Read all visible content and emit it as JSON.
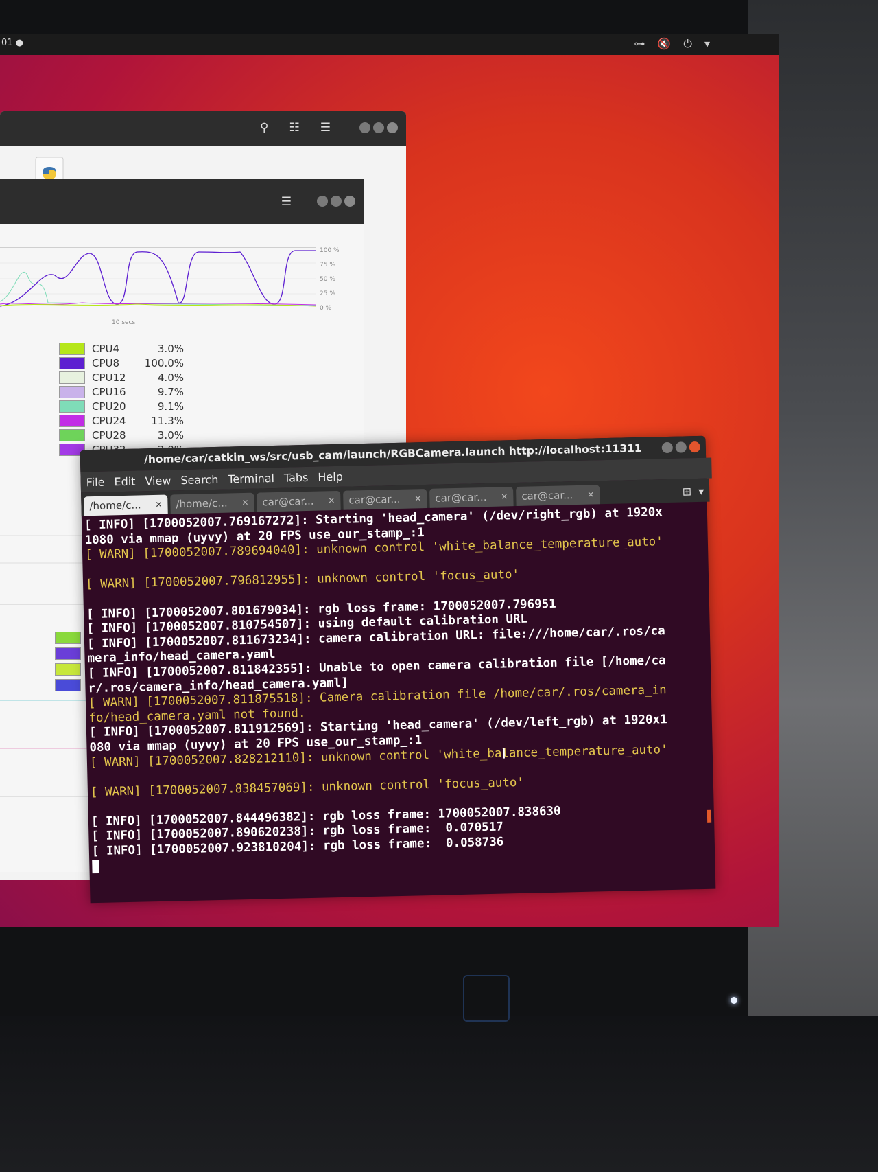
{
  "topbar": {
    "clock": "01 ●",
    "tray_icons": [
      "network-icon",
      "volume-muted-icon",
      "power-icon",
      "chevron-down-icon"
    ]
  },
  "files_window": {
    "icons": [
      "search-icon",
      "view-list-icon",
      "menu-icon"
    ]
  },
  "system_monitor": {
    "axis_labels": [
      "100 %",
      "75 %",
      "50 %",
      "25 %",
      "0 %"
    ],
    "time_label": "10 secs",
    "cpus": [
      {
        "name": "CPU4",
        "value": "3.0%",
        "color": "#b5e619"
      },
      {
        "name": "CPU8",
        "value": "100.0%",
        "color": "#5d1fd1"
      },
      {
        "name": "CPU12",
        "value": "4.0%",
        "color": "#e7f1df"
      },
      {
        "name": "CPU16",
        "value": "9.7%",
        "color": "#c9b2ea"
      },
      {
        "name": "CPU20",
        "value": "9.1%",
        "color": "#7fdcb8"
      },
      {
        "name": "CPU24",
        "value": "11.3%",
        "color": "#c22de6"
      },
      {
        "name": "CPU28",
        "value": "3.0%",
        "color": "#6ed35a"
      },
      {
        "name": "CPU32",
        "value": "2.0%",
        "color": "#a33ae6"
      }
    ],
    "partial_swatch_colors": [
      "#8ad93c",
      "#6a3ed8",
      "#c7e73a",
      "#4a4bd8"
    ]
  },
  "terminal": {
    "title": "/home/car/catkin_ws/src/usb_cam/launch/RGBCamera.launch http://localhost:11311",
    "menu": [
      "File",
      "Edit",
      "View",
      "Search",
      "Terminal",
      "Tabs",
      "Help"
    ],
    "tabs": [
      "/home/c...",
      "/home/c...",
      "car@car...",
      "car@car...",
      "car@car...",
      "car@car..."
    ],
    "lines": [
      {
        "text": "[ INFO] [1700052007.769167272]: Starting 'head_camera' (/dev/right_rgb) at 1920x",
        "level": "info"
      },
      {
        "text": "1080 via mmap (uyvy) at 20 FPS use_our_stamp_:1",
        "level": "info"
      },
      {
        "text": "[ WARN] [1700052007.789694040]: unknown control 'white_balance_temperature_auto'",
        "level": "warn"
      },
      {
        "text": "",
        "level": "info"
      },
      {
        "text": "[ WARN] [1700052007.796812955]: unknown control 'focus_auto'",
        "level": "warn"
      },
      {
        "text": "",
        "level": "info"
      },
      {
        "text": "[ INFO] [1700052007.801679034]: rgb loss frame: 1700052007.796951",
        "level": "info"
      },
      {
        "text": "[ INFO] [1700052007.810754507]: using default calibration URL",
        "level": "info"
      },
      {
        "text": "[ INFO] [1700052007.811673234]: camera calibration URL: file:///home/car/.ros/ca",
        "level": "info"
      },
      {
        "text": "mera_info/head_camera.yaml",
        "level": "info"
      },
      {
        "text": "[ INFO] [1700052007.811842355]: Unable to open camera calibration file [/home/ca",
        "level": "info"
      },
      {
        "text": "r/.ros/camera_info/head_camera.yaml]",
        "level": "info"
      },
      {
        "text": "[ WARN] [1700052007.811875518]: Camera calibration file /home/car/.ros/camera_in",
        "level": "warn"
      },
      {
        "text": "fo/head_camera.yaml not found.",
        "level": "warn"
      },
      {
        "text": "[ INFO] [1700052007.811912569]: Starting 'head_camera' (/dev/left_rgb) at 1920x1",
        "level": "info"
      },
      {
        "text": "080 via mmap (uyvy) at 20 FPS use_our_stamp_:1",
        "level": "info"
      },
      {
        "text": "[ WARN] [1700052007.828212110]: unknown control 'white_balance_temperature_auto'",
        "level": "warn"
      },
      {
        "text": "",
        "level": "info"
      },
      {
        "text": "[ WARN] [1700052007.838457069]: unknown control 'focus_auto'",
        "level": "warn"
      },
      {
        "text": "",
        "level": "info"
      },
      {
        "text": "[ INFO] [1700052007.844496382]: rgb loss frame: 1700052007.838630",
        "level": "info"
      },
      {
        "text": "[ INFO] [1700052007.890620238]: rgb loss frame:  0.070517",
        "level": "info"
      },
      {
        "text": "[ INFO] [1700052007.923810204]: rgb loss frame:  0.058736",
        "level": "info"
      }
    ]
  }
}
